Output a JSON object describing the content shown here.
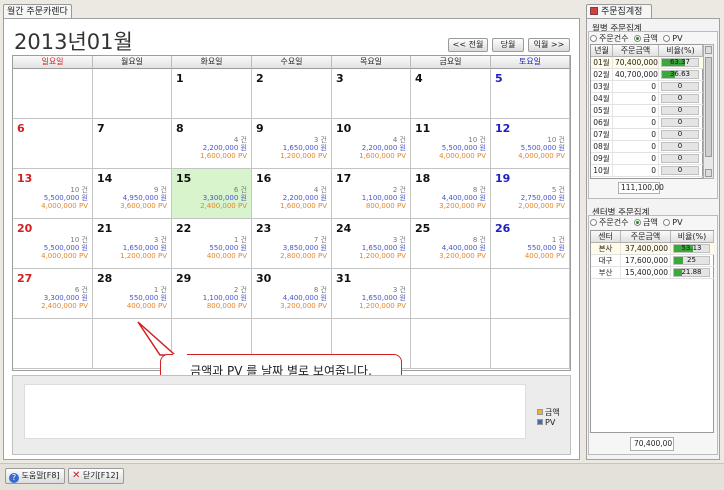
{
  "left_tab": "월간 주문카렌다",
  "right_tab": "주문집계정보",
  "month_title": "2013년01월",
  "nav": {
    "all": "<< 전월",
    "current": "당월",
    "next": "익월 >>"
  },
  "weekdays": [
    "일요일",
    "월요일",
    "화요일",
    "수요일",
    "목요일",
    "금요일",
    "토요일"
  ],
  "weekday_colors": [
    "#d02020",
    "#222222",
    "#222222",
    "#222222",
    "#222222",
    "#222222",
    "#2020c0"
  ],
  "weeks": [
    [
      {
        "d": ""
      },
      {
        "d": ""
      },
      {
        "d": "1"
      },
      {
        "d": "2"
      },
      {
        "d": "3"
      },
      {
        "d": "4"
      },
      {
        "d": "5"
      }
    ],
    [
      {
        "d": "6"
      },
      {
        "d": "7"
      },
      {
        "d": "8",
        "c": "4 건",
        "a": "2,200,000 원",
        "p": "1,600,000 PV"
      },
      {
        "d": "9",
        "c": "3 건",
        "a": "1,650,000 원",
        "p": "1,200,000 PV"
      },
      {
        "d": "10",
        "c": "4 건",
        "a": "2,200,000 원",
        "p": "1,600,000 PV"
      },
      {
        "d": "11",
        "c": "10 건",
        "a": "5,500,000 원",
        "p": "4,000,000 PV"
      },
      {
        "d": "12",
        "c": "10 건",
        "a": "5,500,000 원",
        "p": "4,000,000 PV"
      }
    ],
    [
      {
        "d": "13",
        "c": "10 건",
        "a": "5,500,000 원",
        "p": "4,000,000 PV"
      },
      {
        "d": "14",
        "c": "9 건",
        "a": "4,950,000 원",
        "p": "3,600,000 PV"
      },
      {
        "d": "15",
        "c": "6 건",
        "a": "3,300,000 원",
        "p": "2,400,000 PV",
        "today": true
      },
      {
        "d": "16",
        "c": "4 건",
        "a": "2,200,000 원",
        "p": "1,600,000 PV"
      },
      {
        "d": "17",
        "c": "2 건",
        "a": "1,100,000 원",
        "p": "800,000 PV"
      },
      {
        "d": "18",
        "c": "8 건",
        "a": "4,400,000 원",
        "p": "3,200,000 PV"
      },
      {
        "d": "19",
        "c": "5 건",
        "a": "2,750,000 원",
        "p": "2,000,000 PV"
      }
    ],
    [
      {
        "d": "20",
        "c": "10 건",
        "a": "5,500,000 원",
        "p": "4,000,000 PV"
      },
      {
        "d": "21",
        "c": "3 건",
        "a": "1,650,000 원",
        "p": "1,200,000 PV"
      },
      {
        "d": "22",
        "c": "1 건",
        "a": "550,000 원",
        "p": "400,000 PV"
      },
      {
        "d": "23",
        "c": "7 건",
        "a": "3,850,000 원",
        "p": "2,800,000 PV"
      },
      {
        "d": "24",
        "c": "3 건",
        "a": "1,650,000 원",
        "p": "1,200,000 PV"
      },
      {
        "d": "25",
        "c": "8 건",
        "a": "4,400,000 원",
        "p": "3,200,000 PV"
      },
      {
        "d": "26",
        "c": "1 건",
        "a": "550,000 원",
        "p": "400,000 PV"
      }
    ],
    [
      {
        "d": "27",
        "c": "6 건",
        "a": "3,300,000 원",
        "p": "2,400,000 PV"
      },
      {
        "d": "28",
        "c": "1 건",
        "a": "550,000 원",
        "p": "400,000 PV"
      },
      {
        "d": "29",
        "c": "2 건",
        "a": "1,100,000 원",
        "p": "800,000 PV"
      },
      {
        "d": "30",
        "c": "8 건",
        "a": "4,400,000 원",
        "p": "3,200,000 PV"
      },
      {
        "d": "31",
        "c": "3 건",
        "a": "1,650,000 원",
        "p": "1,200,000 PV"
      },
      {
        "d": ""
      },
      {
        "d": ""
      }
    ],
    [
      {
        "d": ""
      },
      {
        "d": ""
      },
      {
        "d": ""
      },
      {
        "d": ""
      },
      {
        "d": ""
      },
      {
        "d": ""
      },
      {
        "d": ""
      }
    ]
  ],
  "callout": "금액과 PV 를 날짜 별로 보여줍니다.",
  "legend": {
    "amount": "금액",
    "pv": "PV",
    "amount_color": "#f0b030",
    "pv_color": "#4a6ab0"
  },
  "monthly": {
    "title": "월별 주문집계",
    "radios": [
      "주문건수",
      "금액",
      "PV"
    ],
    "selected": 1,
    "headers": [
      "년월",
      "주문금액",
      "비율(%)"
    ],
    "rows": [
      {
        "m": "01월",
        "amt": "70,400,000",
        "pct": 63.37,
        "pl": "63.37"
      },
      {
        "m": "02월",
        "amt": "40,700,000",
        "pct": 36.63,
        "pl": "36.63"
      },
      {
        "m": "03월",
        "amt": "0",
        "pct": 0,
        "pl": "0"
      },
      {
        "m": "04월",
        "amt": "0",
        "pct": 0,
        "pl": "0"
      },
      {
        "m": "05월",
        "amt": "0",
        "pct": 0,
        "pl": "0"
      },
      {
        "m": "06월",
        "amt": "0",
        "pct": 0,
        "pl": "0"
      },
      {
        "m": "07월",
        "amt": "0",
        "pct": 0,
        "pl": "0"
      },
      {
        "m": "08월",
        "amt": "0",
        "pct": 0,
        "pl": "0"
      },
      {
        "m": "09월",
        "amt": "0",
        "pct": 0,
        "pl": "0"
      },
      {
        "m": "10월",
        "amt": "0",
        "pct": 0,
        "pl": "0"
      }
    ],
    "total": "111,100,00"
  },
  "center": {
    "title": "센터별 주문집계",
    "radios": [
      "주문건수",
      "금액",
      "PV"
    ],
    "selected": 1,
    "headers": [
      "센터",
      "주문금액",
      "비율(%)"
    ],
    "rows": [
      {
        "m": "본사",
        "amt": "37,400,000",
        "pct": 53.13,
        "pl": "53.13"
      },
      {
        "m": "대구",
        "amt": "17,600,000",
        "pct": 25,
        "pl": "25"
      },
      {
        "m": "부산",
        "amt": "15,400,000",
        "pct": 21.88,
        "pl": "21.88"
      }
    ],
    "total": "70,400,00"
  },
  "footer": {
    "help": "도움말[F8]",
    "close": "닫기[F12]"
  }
}
